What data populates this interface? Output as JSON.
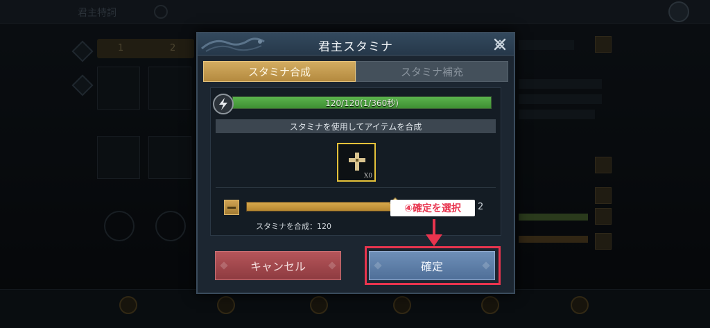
{
  "background": {
    "screen_title": "君主特詞",
    "tab_numbers": [
      "1",
      "2"
    ]
  },
  "dialog": {
    "title": "君主スタミナ",
    "tabs": [
      {
        "label": "スタミナ合成",
        "active": true
      },
      {
        "label": "スタミナ補充",
        "active": false
      }
    ],
    "stamina": {
      "text": "120/120(1/360秒)",
      "current": 120,
      "max": 120
    },
    "section_title": "スタミナを使用してアイテムを合成",
    "item": {
      "count_label": "X0",
      "icon": "cross-icon"
    },
    "slider": {
      "max_label": "2",
      "fill_fraction": 0.95
    },
    "combine_label": "スタミナを合成：120",
    "buttons": {
      "cancel": "キャンセル",
      "confirm": "確定"
    }
  },
  "annotation": {
    "text": "④確定を選択",
    "color": "#e8344e"
  },
  "colors": {
    "tab_active": "#c79d52",
    "stamina_fill": "#4ea23f",
    "cancel_button": "#a2484d",
    "confirm_button": "#5f7fa8",
    "highlight": "#e8344e"
  }
}
